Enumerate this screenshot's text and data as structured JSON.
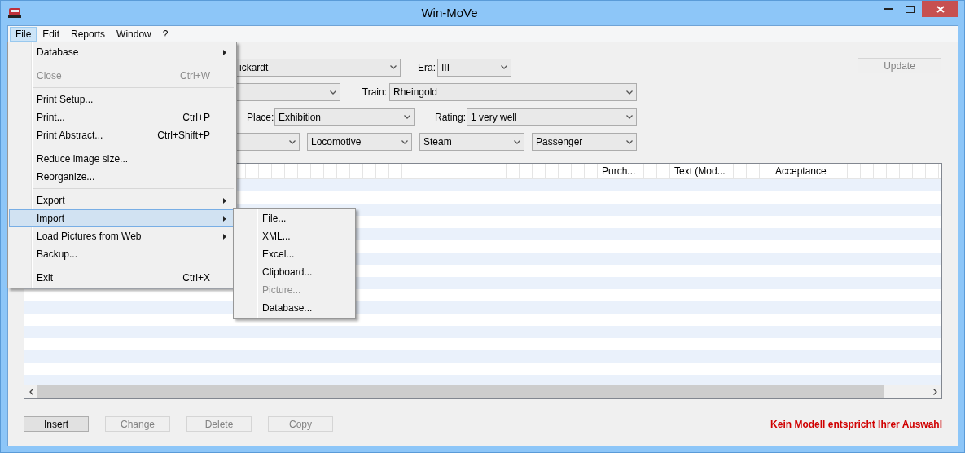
{
  "window": {
    "title": "Win-MoVe"
  },
  "menubar": [
    {
      "label": "File",
      "selected": true
    },
    {
      "label": "Edit",
      "selected": false
    },
    {
      "label": "Reports",
      "selected": false
    },
    {
      "label": "Window",
      "selected": false
    },
    {
      "label": "?",
      "selected": false
    }
  ],
  "file_menu": [
    {
      "kind": "item",
      "label": "Database",
      "submenu": true,
      "disabled": false,
      "selected": false
    },
    {
      "kind": "separator"
    },
    {
      "kind": "item",
      "label": "Close",
      "shortcut": "Ctrl+W",
      "submenu": false,
      "disabled": true,
      "selected": false
    },
    {
      "kind": "separator"
    },
    {
      "kind": "item",
      "label": "Print Setup...",
      "submenu": false,
      "disabled": false,
      "selected": false
    },
    {
      "kind": "item",
      "label": "Print...",
      "shortcut": "Ctrl+P",
      "submenu": false,
      "disabled": false,
      "selected": false
    },
    {
      "kind": "item",
      "label": "Print Abstract...",
      "shortcut": "Ctrl+Shift+P",
      "submenu": false,
      "disabled": false,
      "selected": false
    },
    {
      "kind": "separator"
    },
    {
      "kind": "item",
      "label": "Reduce image size...",
      "submenu": false,
      "disabled": false,
      "selected": false
    },
    {
      "kind": "item",
      "label": "Reorganize...",
      "submenu": false,
      "disabled": false,
      "selected": false
    },
    {
      "kind": "separator"
    },
    {
      "kind": "item",
      "label": "Export",
      "submenu": true,
      "disabled": false,
      "selected": false
    },
    {
      "kind": "item",
      "label": "Import",
      "submenu": true,
      "disabled": false,
      "selected": true
    },
    {
      "kind": "item",
      "label": "Load Pictures from Web",
      "submenu": true,
      "disabled": false,
      "selected": false
    },
    {
      "kind": "item",
      "label": "Backup...",
      "submenu": false,
      "disabled": false,
      "selected": false
    },
    {
      "kind": "separator"
    },
    {
      "kind": "item",
      "label": "Exit",
      "shortcut": "Ctrl+X",
      "submenu": false,
      "disabled": false,
      "selected": false
    }
  ],
  "import_submenu": [
    {
      "label": "File...",
      "disabled": false
    },
    {
      "label": "XML...",
      "disabled": false
    },
    {
      "label": "Excel...",
      "disabled": false
    },
    {
      "label": "Clipboard...",
      "disabled": false
    },
    {
      "label": "Picture...",
      "disabled": true
    },
    {
      "label": "Database...",
      "disabled": false
    }
  ],
  "filters": [
    [
      {
        "kind": "dropdown",
        "value": "ickardt"
      },
      {
        "kind": "dropdown",
        "label": "Era:",
        "value": "III"
      }
    ],
    [
      {
        "kind": "dropdown"
      },
      {
        "kind": "dropdown",
        "label": "Train:",
        "value": "Rheingold"
      }
    ],
    [
      {
        "kind": "dropdown",
        "label": "Place:",
        "value": "Exhibition"
      },
      {
        "kind": "dropdown",
        "label": "Rating:",
        "value": "1 very well"
      }
    ],
    [
      {
        "kind": "dropdown"
      },
      {
        "kind": "dropdown",
        "value": "Locomotive"
      },
      {
        "kind": "dropdown",
        "value": "Steam"
      },
      {
        "kind": "dropdown",
        "value": "Passenger"
      }
    ]
  ],
  "update_button": {
    "label": "Update",
    "disabled": true
  },
  "table": {
    "columns": [
      "Purch...",
      "Text (Mod...",
      "Acceptance"
    ]
  },
  "buttons": [
    {
      "label": "Insert",
      "disabled": false
    },
    {
      "label": "Change",
      "disabled": true
    },
    {
      "label": "Delete",
      "disabled": true
    },
    {
      "label": "Copy",
      "disabled": true
    }
  ],
  "status_message": "Kein Modell entspricht Ihrer Auswahl"
}
